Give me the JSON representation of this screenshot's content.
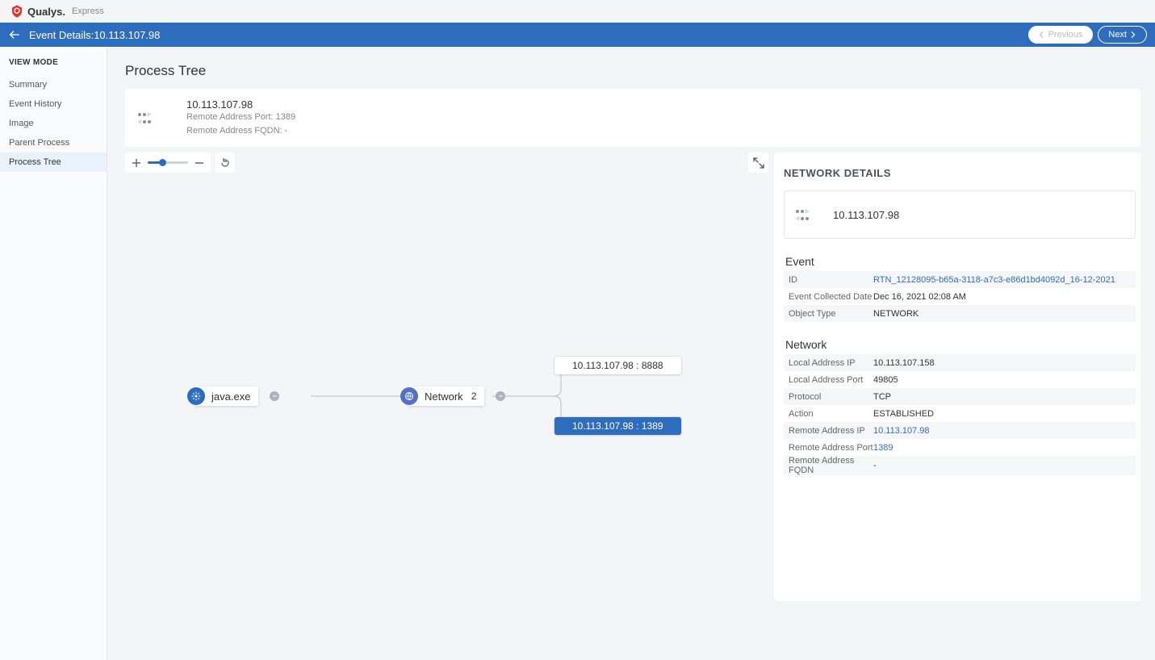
{
  "brand": {
    "name": "Qualys.",
    "product": "Express"
  },
  "header": {
    "title_prefix": "Event Details:",
    "title_ip": "10.113.107.98",
    "prev": "Previous",
    "next": "Next"
  },
  "sidebar": {
    "title": "VIEW MODE",
    "items": [
      {
        "label": "Summary"
      },
      {
        "label": "Event History"
      },
      {
        "label": "Image"
      },
      {
        "label": "Parent Process"
      },
      {
        "label": "Process Tree",
        "active": true
      }
    ]
  },
  "page_title": "Process Tree",
  "banner": {
    "ip": "10.113.107.98",
    "line1_label": "Remote Address Port:",
    "line1_value": "1389",
    "line2_label": "Remote Address FQDN:",
    "line2_value": "-"
  },
  "tree": {
    "root": {
      "label": "java.exe"
    },
    "group": {
      "label": "Network",
      "count": "2"
    },
    "leaf1": "10.113.107.98 : 8888",
    "leaf2": "10.113.107.98 : 1389"
  },
  "details": {
    "title": "NETWORK DETAILS",
    "ip": "10.113.107.98",
    "event_heading": "Event",
    "event": [
      {
        "key": "ID",
        "val": "RTN_12128095-b65a-3118-a7c3-e86d1bd4092d_16-12-2021",
        "link": true
      },
      {
        "key": "Event Collected Date",
        "val": "Dec 16, 2021 02:08 AM"
      },
      {
        "key": "Object Type",
        "val": "NETWORK"
      }
    ],
    "network_heading": "Network",
    "network": [
      {
        "key": "Local Address IP",
        "val": "10.113.107.158"
      },
      {
        "key": "Local Address Port",
        "val": "49805"
      },
      {
        "key": "Protocol",
        "val": "TCP"
      },
      {
        "key": "Action",
        "val": "ESTABLISHED"
      },
      {
        "key": "Remote Address IP",
        "val": "10.113.107.98",
        "link": true
      },
      {
        "key": "Remote Address Port",
        "val": "1389",
        "link": true
      },
      {
        "key": "Remote Address FQDN",
        "val": "-"
      }
    ]
  }
}
